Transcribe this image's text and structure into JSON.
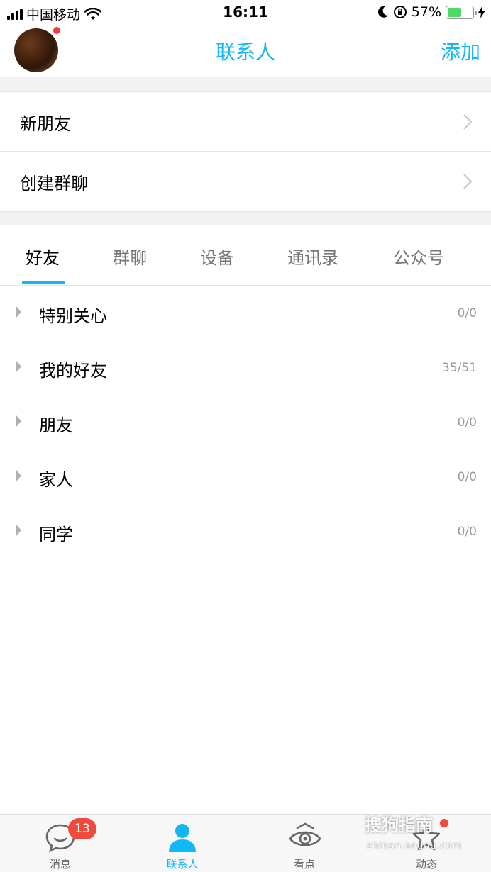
{
  "status_bar": {
    "carrier": "中国移动",
    "time": "16:11",
    "battery_percent": "57%",
    "battery_level": 0.57,
    "icons": [
      "signal-icon",
      "wifi-icon",
      "moon-icon",
      "orientation-lock-icon",
      "battery-icon",
      "charging-icon"
    ]
  },
  "header": {
    "title": "联系人",
    "add_label": "添加",
    "avatar_has_notification": true
  },
  "menu_rows": [
    {
      "label": "新朋友"
    },
    {
      "label": "创建群聊"
    }
  ],
  "tabs": [
    {
      "label": "好友",
      "active": true
    },
    {
      "label": "群聊",
      "active": false
    },
    {
      "label": "设备",
      "active": false
    },
    {
      "label": "通讯录",
      "active": false
    },
    {
      "label": "公众号",
      "active": false
    }
  ],
  "groups": [
    {
      "name": "特别关心",
      "count": "0/0"
    },
    {
      "name": "我的好友",
      "count": "35/51"
    },
    {
      "name": "朋友",
      "count": "0/0"
    },
    {
      "name": "家人",
      "count": "0/0"
    },
    {
      "name": "同学",
      "count": "0/0"
    }
  ],
  "bottom_tabs": [
    {
      "label": "消息",
      "icon": "chat-bubble-icon",
      "badge": "13",
      "active": false
    },
    {
      "label": "联系人",
      "icon": "person-icon",
      "active": true
    },
    {
      "label": "看点",
      "icon": "eye-icon",
      "active": false
    },
    {
      "label": "动态",
      "icon": "star-icon",
      "active": false,
      "dot": true
    }
  ],
  "watermark": {
    "text": "搜狗指南",
    "url": "zhinan.sogou.com"
  },
  "colors": {
    "accent": "#12b7f5",
    "badge": "#f04a3d",
    "battery": "#4cd964"
  }
}
